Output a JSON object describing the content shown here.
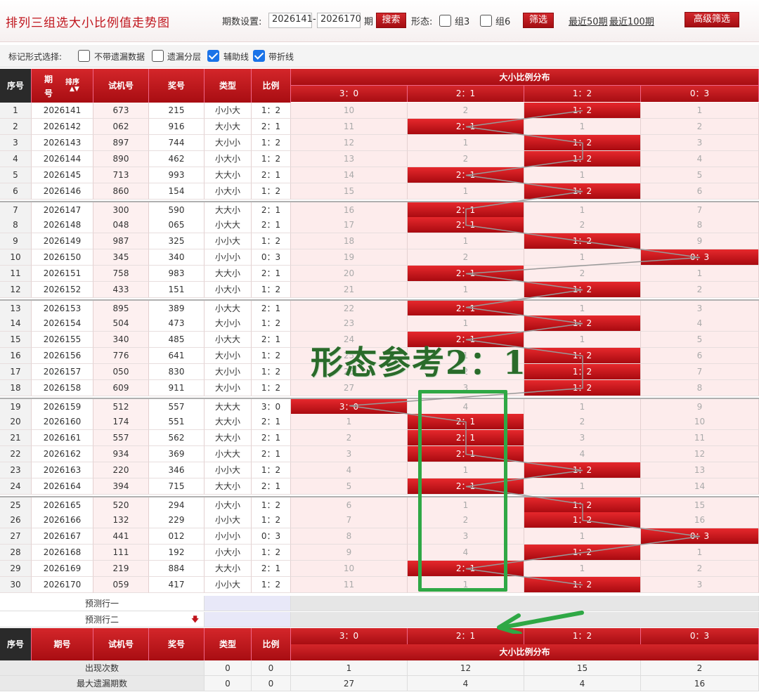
{
  "header": {
    "title": "排列三组选大小比例值走势图",
    "period_label": "期数设置:",
    "period_from": "2026141",
    "period_dash": "-",
    "period_to": "2026170",
    "period_unit": "期",
    "search_button": "搜索",
    "form_label": "形态:",
    "zu3_label": "组3",
    "zu6_label": "组6",
    "filter_button": "筛选",
    "recent50": "最近50期",
    "recent100": "最近100期",
    "advanced_button": "高级筛选"
  },
  "mark_options": {
    "label": "标记形式选择:",
    "items": [
      {
        "label": "不带遗漏数据",
        "checked": false
      },
      {
        "label": "遗漏分层",
        "checked": false
      },
      {
        "label": "辅助线",
        "checked": true
      },
      {
        "label": "带折线",
        "checked": true
      }
    ]
  },
  "table": {
    "headers": {
      "index": "序号",
      "period_top": "期",
      "period_bottom": "号",
      "sort": "排序",
      "trial": "试机号",
      "draw": "奖号",
      "type": "类型",
      "ratio": "比例",
      "dist": "大小比例分布",
      "period_full": "期号"
    },
    "ratio_cols": [
      "3：0",
      "2：1",
      "1：2",
      "0：3"
    ],
    "rows": [
      {
        "i": "1",
        "p": "2026141",
        "t": "673",
        "d": "215",
        "ty": "小小大",
        "r": "1：2",
        "hit": 2,
        "m": [
          "10",
          "2",
          "1：2",
          "1"
        ]
      },
      {
        "i": "2",
        "p": "2026142",
        "t": "062",
        "d": "916",
        "ty": "大小大",
        "r": "2：1",
        "hit": 1,
        "m": [
          "11",
          "2：1",
          "1",
          "2"
        ]
      },
      {
        "i": "3",
        "p": "2026143",
        "t": "897",
        "d": "744",
        "ty": "大小小",
        "r": "1：2",
        "hit": 2,
        "m": [
          "12",
          "1",
          "1：2",
          "3"
        ]
      },
      {
        "i": "4",
        "p": "2026144",
        "t": "890",
        "d": "462",
        "ty": "小大小",
        "r": "1：2",
        "hit": 2,
        "m": [
          "13",
          "2",
          "1：2",
          "4"
        ]
      },
      {
        "i": "5",
        "p": "2026145",
        "t": "713",
        "d": "993",
        "ty": "大大小",
        "r": "2：1",
        "hit": 1,
        "m": [
          "14",
          "2：1",
          "1",
          "5"
        ]
      },
      {
        "i": "6",
        "p": "2026146",
        "t": "860",
        "d": "154",
        "ty": "小大小",
        "r": "1：2",
        "hit": 2,
        "m": [
          "15",
          "1",
          "1：2",
          "6"
        ]
      },
      {
        "i": "7",
        "p": "2026147",
        "t": "300",
        "d": "590",
        "ty": "大大小",
        "r": "2：1",
        "hit": 1,
        "m": [
          "16",
          "2：1",
          "1",
          "7"
        ]
      },
      {
        "i": "8",
        "p": "2026148",
        "t": "048",
        "d": "065",
        "ty": "小大大",
        "r": "2：1",
        "hit": 1,
        "m": [
          "17",
          "2：1",
          "2",
          "8"
        ]
      },
      {
        "i": "9",
        "p": "2026149",
        "t": "987",
        "d": "325",
        "ty": "小小大",
        "r": "1：2",
        "hit": 2,
        "m": [
          "18",
          "1",
          "1：2",
          "9"
        ]
      },
      {
        "i": "10",
        "p": "2026150",
        "t": "345",
        "d": "340",
        "ty": "小小小",
        "r": "0：3",
        "hit": 3,
        "m": [
          "19",
          "2",
          "1",
          "0：3"
        ]
      },
      {
        "i": "11",
        "p": "2026151",
        "t": "758",
        "d": "983",
        "ty": "大大小",
        "r": "2：1",
        "hit": 1,
        "m": [
          "20",
          "2：1",
          "2",
          "1"
        ]
      },
      {
        "i": "12",
        "p": "2026152",
        "t": "433",
        "d": "151",
        "ty": "小大小",
        "r": "1：2",
        "hit": 2,
        "m": [
          "21",
          "1",
          "1：2",
          "2"
        ]
      },
      {
        "i": "13",
        "p": "2026153",
        "t": "895",
        "d": "389",
        "ty": "小大大",
        "r": "2：1",
        "hit": 1,
        "m": [
          "22",
          "2：1",
          "1",
          "3"
        ]
      },
      {
        "i": "14",
        "p": "2026154",
        "t": "504",
        "d": "473",
        "ty": "大小小",
        "r": "1：2",
        "hit": 2,
        "m": [
          "23",
          "1",
          "1：2",
          "4"
        ]
      },
      {
        "i": "15",
        "p": "2026155",
        "t": "340",
        "d": "485",
        "ty": "小大大",
        "r": "2：1",
        "hit": 1,
        "m": [
          "24",
          "2：1",
          "1",
          "5"
        ]
      },
      {
        "i": "16",
        "p": "2026156",
        "t": "776",
        "d": "641",
        "ty": "大小小",
        "r": "1：2",
        "hit": 2,
        "m": [
          "25",
          "1",
          "1：2",
          "6"
        ]
      },
      {
        "i": "17",
        "p": "2026157",
        "t": "050",
        "d": "830",
        "ty": "大小小",
        "r": "1：2",
        "hit": 2,
        "m": [
          "26",
          "2",
          "1：2",
          "7"
        ]
      },
      {
        "i": "18",
        "p": "2026158",
        "t": "609",
        "d": "911",
        "ty": "大小小",
        "r": "1：2",
        "hit": 2,
        "m": [
          "27",
          "3",
          "1：2",
          "8"
        ]
      },
      {
        "i": "19",
        "p": "2026159",
        "t": "512",
        "d": "557",
        "ty": "大大大",
        "r": "3：0",
        "hit": 0,
        "m": [
          "3：0",
          "4",
          "1",
          "9"
        ]
      },
      {
        "i": "20",
        "p": "2026160",
        "t": "174",
        "d": "551",
        "ty": "大大小",
        "r": "2：1",
        "hit": 1,
        "m": [
          "1",
          "2：1",
          "2",
          "10"
        ]
      },
      {
        "i": "21",
        "p": "2026161",
        "t": "557",
        "d": "562",
        "ty": "大大小",
        "r": "2：1",
        "hit": 1,
        "m": [
          "2",
          "2：1",
          "3",
          "11"
        ]
      },
      {
        "i": "22",
        "p": "2026162",
        "t": "934",
        "d": "369",
        "ty": "小大大",
        "r": "2：1",
        "hit": 1,
        "m": [
          "3",
          "2：1",
          "4",
          "12"
        ]
      },
      {
        "i": "23",
        "p": "2026163",
        "t": "220",
        "d": "346",
        "ty": "小小大",
        "r": "1：2",
        "hit": 2,
        "m": [
          "4",
          "1",
          "1：2",
          "13"
        ]
      },
      {
        "i": "24",
        "p": "2026164",
        "t": "394",
        "d": "715",
        "ty": "大大小",
        "r": "2：1",
        "hit": 1,
        "m": [
          "5",
          "2：1",
          "1",
          "14"
        ]
      },
      {
        "i": "25",
        "p": "2026165",
        "t": "520",
        "d": "294",
        "ty": "小大小",
        "r": "1：2",
        "hit": 2,
        "m": [
          "6",
          "1",
          "1：2",
          "15"
        ]
      },
      {
        "i": "26",
        "p": "2026166",
        "t": "132",
        "d": "229",
        "ty": "小小大",
        "r": "1：2",
        "hit": 2,
        "m": [
          "7",
          "2",
          "1：2",
          "16"
        ]
      },
      {
        "i": "27",
        "p": "2026167",
        "t": "441",
        "d": "012",
        "ty": "小小小",
        "r": "0：3",
        "hit": 3,
        "m": [
          "8",
          "3",
          "1",
          "0：3"
        ]
      },
      {
        "i": "28",
        "p": "2026168",
        "t": "111",
        "d": "192",
        "ty": "小大小",
        "r": "1：2",
        "hit": 2,
        "m": [
          "9",
          "4",
          "1：2",
          "1"
        ]
      },
      {
        "i": "29",
        "p": "2026169",
        "t": "219",
        "d": "884",
        "ty": "大大小",
        "r": "2：1",
        "hit": 1,
        "m": [
          "10",
          "2：1",
          "1",
          "2"
        ]
      },
      {
        "i": "30",
        "p": "2026170",
        "t": "059",
        "d": "417",
        "ty": "小小大",
        "r": "1：2",
        "hit": 2,
        "m": [
          "11",
          "1",
          "1：2",
          "3"
        ]
      }
    ],
    "predict1": "预测行一",
    "predict2": "预测行二",
    "stats": [
      {
        "label": "出现次数",
        "type": "0",
        "ratio": "0",
        "vals": [
          "1",
          "12",
          "15",
          "2"
        ]
      },
      {
        "label": "最大遗漏期数",
        "type": "0",
        "ratio": "0",
        "vals": [
          "27",
          "4",
          "4",
          "16"
        ]
      }
    ]
  },
  "overlay": {
    "note": "形态参考2：1"
  },
  "colors": {
    "accent": "#c0141c",
    "hit": "#c8161c",
    "green": "#2fa845"
  }
}
